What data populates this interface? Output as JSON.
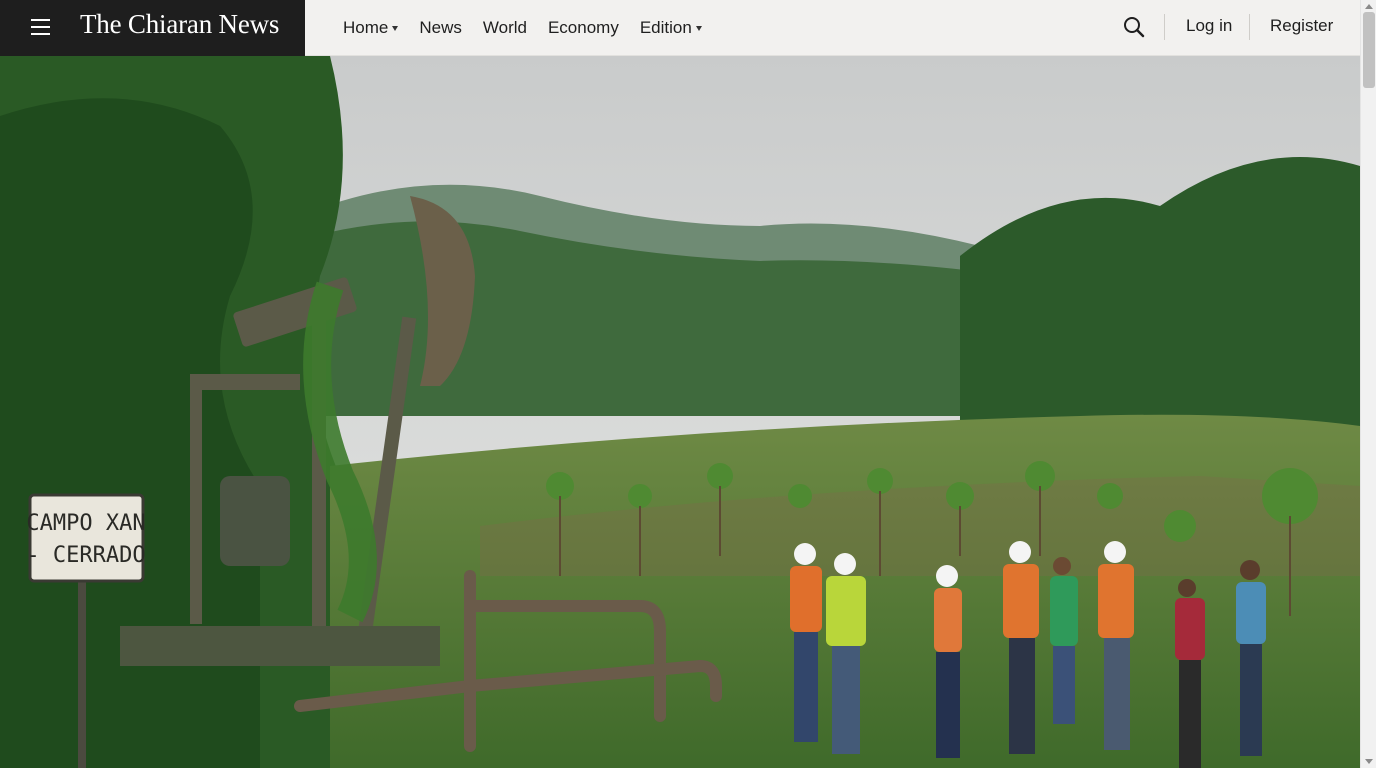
{
  "site": {
    "title": "The Chiaran News"
  },
  "nav": {
    "items": [
      {
        "label": "Home",
        "has_dropdown": true
      },
      {
        "label": "News",
        "has_dropdown": false
      },
      {
        "label": "World",
        "has_dropdown": false
      },
      {
        "label": "Economy",
        "has_dropdown": false
      },
      {
        "label": "Edition",
        "has_dropdown": true
      }
    ]
  },
  "actions": {
    "login_label": "Log in",
    "register_label": "Register"
  },
  "icons": {
    "menu": "hamburger-menu-icon",
    "search": "search-icon"
  },
  "hero": {
    "sign_line1": "CAMPO XAN",
    "sign_line2": "- CERRADO"
  },
  "colors": {
    "brand_block": "#1e1e1e",
    "header_bg": "#f2f1ef",
    "text": "#1f1f1f"
  }
}
